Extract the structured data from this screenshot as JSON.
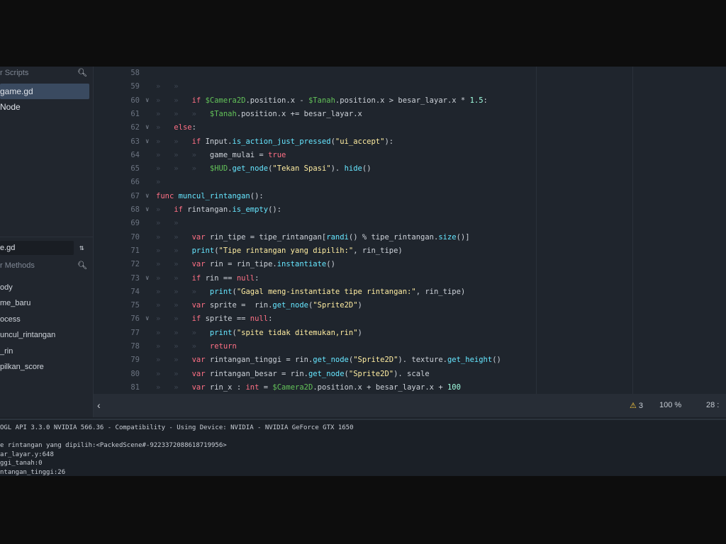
{
  "left_panel": {
    "scripts_filter_placeholder": "r Scripts",
    "scripts": [
      "game.gd",
      "Node"
    ],
    "current_script": "e.gd",
    "methods_filter_placeholder": "r Methods",
    "methods": [
      "ody",
      "me_baru",
      "ocess",
      "uncul_rintangan",
      "_rin",
      "pilkan_score"
    ]
  },
  "code_lines": [
    {
      "n": "58",
      "fold": "",
      "indent": 0,
      "tokens": []
    },
    {
      "n": "59",
      "fold": "",
      "indent": 2,
      "tokens": []
    },
    {
      "n": "60",
      "fold": "v",
      "indent": 2,
      "tokens": [
        [
          "kw",
          "if "
        ],
        [
          "node",
          "$Camera2D"
        ],
        [
          "",
          "."
        ],
        [
          "",
          "position"
        ],
        [
          "",
          ".x - "
        ],
        [
          "node",
          "$Tanah"
        ],
        [
          "",
          ".position.x > besar_layar.x * "
        ],
        [
          "num",
          "1.5"
        ],
        [
          "",
          ":"
        ]
      ]
    },
    {
      "n": "61",
      "fold": "",
      "indent": 3,
      "tokens": [
        [
          "node",
          "$Tanah"
        ],
        [
          "",
          ".position.x += besar_layar.x"
        ]
      ]
    },
    {
      "n": "62",
      "fold": "v",
      "indent": 1,
      "tokens": [
        [
          "kw",
          "else"
        ],
        [
          "",
          ":"
        ]
      ]
    },
    {
      "n": "63",
      "fold": "v",
      "indent": 2,
      "tokens": [
        [
          "kw",
          "if "
        ],
        [
          "",
          "Input."
        ],
        [
          "fn",
          "is_action_just_pressed"
        ],
        [
          "",
          "("
        ],
        [
          "str",
          "\"ui_accept\""
        ],
        [
          "",
          "):"
        ]
      ]
    },
    {
      "n": "64",
      "fold": "",
      "indent": 3,
      "tokens": [
        [
          "",
          "game_mulai = "
        ],
        [
          "bool",
          "true"
        ]
      ]
    },
    {
      "n": "65",
      "fold": "",
      "indent": 3,
      "tokens": [
        [
          "node",
          "$HUD"
        ],
        [
          "",
          "."
        ],
        [
          "fn",
          "get_node"
        ],
        [
          "",
          "("
        ],
        [
          "str",
          "\"Tekan Spasi\""
        ],
        [
          "",
          "). "
        ],
        [
          "fn",
          "hide"
        ],
        [
          "",
          "()"
        ]
      ]
    },
    {
      "n": "66",
      "fold": "",
      "indent": 1,
      "tokens": []
    },
    {
      "n": "67",
      "fold": "v",
      "indent": 0,
      "tokens": [
        [
          "kw",
          "func "
        ],
        [
          "fn",
          "muncul_rintangan"
        ],
        [
          "",
          "():"
        ]
      ]
    },
    {
      "n": "68",
      "fold": "v",
      "indent": 1,
      "tokens": [
        [
          "kw",
          "if "
        ],
        [
          "",
          "rintangan."
        ],
        [
          "fn",
          "is_empty"
        ],
        [
          "",
          "():"
        ]
      ]
    },
    {
      "n": "69",
      "fold": "",
      "indent": 2,
      "tokens": []
    },
    {
      "n": "70",
      "fold": "",
      "indent": 2,
      "tokens": [
        [
          "kw",
          "var "
        ],
        [
          "",
          "rin_tipe = tipe_rintangan["
        ],
        [
          "fn",
          "randi"
        ],
        [
          "",
          "() % tipe_rintangan."
        ],
        [
          "fn",
          "size"
        ],
        [
          "",
          "()]"
        ]
      ]
    },
    {
      "n": "71",
      "fold": "",
      "indent": 2,
      "tokens": [
        [
          "fn",
          "print"
        ],
        [
          "",
          "("
        ],
        [
          "str",
          "\"Tipe rintangan yang dipilih:\""
        ],
        [
          "",
          ", rin_tipe)"
        ]
      ]
    },
    {
      "n": "72",
      "fold": "",
      "indent": 2,
      "tokens": [
        [
          "kw",
          "var "
        ],
        [
          "",
          "rin = rin_tipe."
        ],
        [
          "fn",
          "instantiate"
        ],
        [
          "",
          "()"
        ]
      ]
    },
    {
      "n": "73",
      "fold": "v",
      "indent": 2,
      "tokens": [
        [
          "kw",
          "if "
        ],
        [
          "",
          "rin == "
        ],
        [
          "kw",
          "null"
        ],
        [
          "",
          ":"
        ]
      ]
    },
    {
      "n": "74",
      "fold": "",
      "indent": 3,
      "tokens": [
        [
          "fn",
          "print"
        ],
        [
          "",
          "("
        ],
        [
          "str",
          "\"Gagal meng-instantiate tipe rintangan:\""
        ],
        [
          "",
          ", rin_tipe)"
        ]
      ]
    },
    {
      "n": "75",
      "fold": "",
      "indent": 2,
      "tokens": [
        [
          "kw",
          "var "
        ],
        [
          "",
          "sprite =  rin."
        ],
        [
          "fn",
          "get_node"
        ],
        [
          "",
          "("
        ],
        [
          "str",
          "\"Sprite2D\""
        ],
        [
          "",
          ")"
        ]
      ]
    },
    {
      "n": "76",
      "fold": "v",
      "indent": 2,
      "tokens": [
        [
          "kw",
          "if "
        ],
        [
          "",
          "sprite == "
        ],
        [
          "kw",
          "null"
        ],
        [
          "",
          ":"
        ]
      ]
    },
    {
      "n": "77",
      "fold": "",
      "indent": 3,
      "tokens": [
        [
          "fn",
          "print"
        ],
        [
          "",
          "("
        ],
        [
          "str",
          "\"spite tidak ditemukan,rin\""
        ],
        [
          "",
          ")"
        ]
      ]
    },
    {
      "n": "78",
      "fold": "",
      "indent": 3,
      "tokens": [
        [
          "kw",
          "return"
        ]
      ]
    },
    {
      "n": "79",
      "fold": "",
      "indent": 2,
      "tokens": [
        [
          "kw",
          "var "
        ],
        [
          "",
          "rintangan_tinggi = rin."
        ],
        [
          "fn",
          "get_node"
        ],
        [
          "",
          "("
        ],
        [
          "str",
          "\"Sprite2D\""
        ],
        [
          "",
          "). texture."
        ],
        [
          "fn",
          "get_height"
        ],
        [
          "",
          "()"
        ]
      ]
    },
    {
      "n": "80",
      "fold": "",
      "indent": 2,
      "tokens": [
        [
          "kw",
          "var "
        ],
        [
          "",
          "rintangan_besar = rin."
        ],
        [
          "fn",
          "get_node"
        ],
        [
          "",
          "("
        ],
        [
          "str",
          "\"Sprite2D\""
        ],
        [
          "",
          "). scale"
        ]
      ]
    },
    {
      "n": "81",
      "fold": "",
      "indent": 2,
      "tokens": [
        [
          "kw",
          "var "
        ],
        [
          "",
          "rin_x : "
        ],
        [
          "kw",
          "int"
        ],
        [
          "",
          " = "
        ],
        [
          "node",
          "$Camera2D"
        ],
        [
          "",
          ".position.x + besar_layar.x + "
        ],
        [
          "num",
          "100"
        ]
      ]
    }
  ],
  "status_bar": {
    "back_icon": "chevron-left-icon",
    "warnings": "3",
    "zoom": "100 %",
    "column": "28 :"
  },
  "output_lines": [
    "OGL API 3.3.0 NVIDIA 566.36 - Compatibility - Using Device: NVIDIA - NVIDIA GeForce GTX 1650",
    "",
    "e rintangan yang dipilih:<PackedScene#-9223372088618719956>",
    "ar_layar.y:648",
    "ggi_tanah:0",
    "ntangan_tinggi:26"
  ],
  "colors": {
    "keyword": "#ff7085",
    "function": "#66e6ff",
    "string": "#ffeda1",
    "node_path": "#63c259",
    "number": "#a1ffe0",
    "selection": "#3a4a60"
  }
}
